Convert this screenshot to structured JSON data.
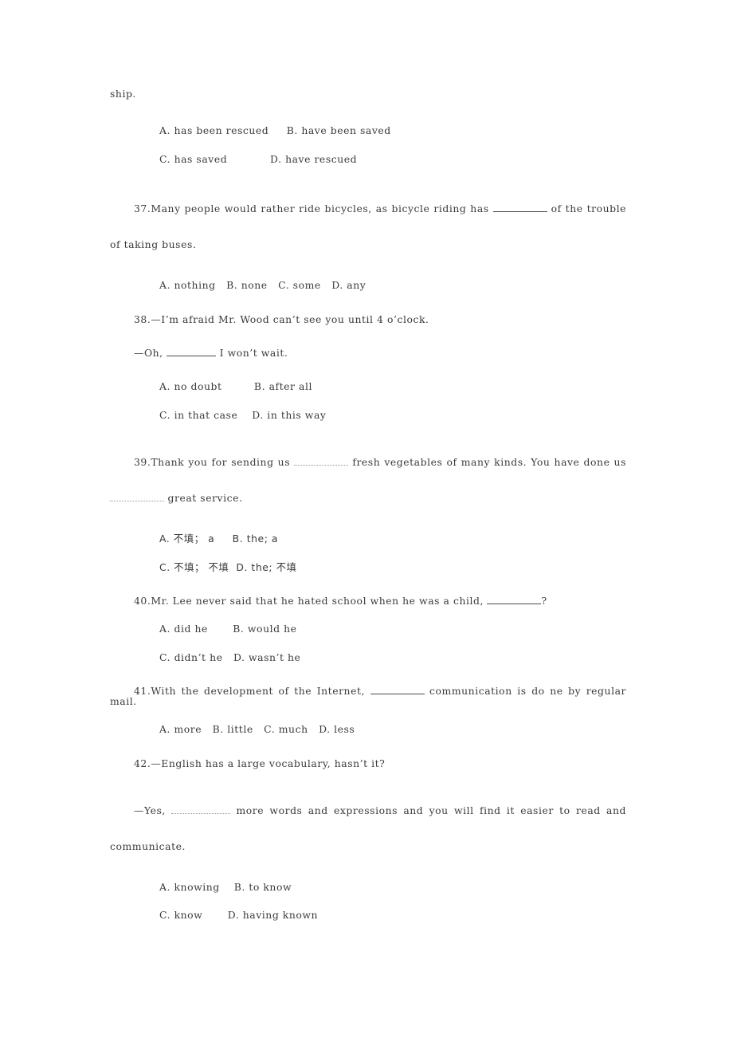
{
  "page": {
    "carryover_text": "ship.",
    "questions": [
      {
        "id": "q36",
        "number": "",
        "stem": "",
        "options_rows": [
          "A. has been rescued     B. have been saved",
          "C. has saved            D. have rescued"
        ]
      },
      {
        "id": "q37",
        "number": "37.",
        "stem_before_blank": "Many people would rather ride bicycles, as bicycle riding has ",
        "stem_after_blank": " of the trouble of taking buses.",
        "blank_style": "solid",
        "options_rows": [
          "A. nothing   B. none   C. some   D. any"
        ]
      },
      {
        "id": "q38",
        "number": "38.",
        "stem": "—I’m afraid Mr. Wood can’t see you until 4 o’clock.",
        "reply_before_blank": "—Oh, ",
        "reply_after_blank": " I won’t wait.",
        "blank_style": "solid",
        "options_rows": [
          "A. no doubt         B. after all",
          "C. in that case    D. in this way"
        ]
      },
      {
        "id": "q39",
        "number": "39.",
        "stem_before_blank": "Thank you for sending us ",
        "stem_mid": " fresh vegetables of many kinds. You have done us ",
        "stem_after_blank": " great service.",
        "blank_style": "faint",
        "options_rows": [
          "A. 不填； a     B. the; a",
          "C. 不填； 不填  D. the; 不填"
        ]
      },
      {
        "id": "q40",
        "number": "40.",
        "stem_before_blank": "Mr. Lee never said that he hated school when he was a child, ",
        "stem_after_blank": "?",
        "blank_style": "solid",
        "options_rows": [
          "A. did he       B. would he",
          "C. didn’t he   D. wasn’t he"
        ]
      },
      {
        "id": "q41",
        "number": "41.",
        "stem_before_blank": "With the development of the Internet, ",
        "stem_after_blank": " communication is do ne by regular mail.",
        "blank_style": "solid",
        "options_rows": [
          "A. more   B. little   C. much   D. less"
        ]
      },
      {
        "id": "q42",
        "number": "42.",
        "stem": "—English has a large vocabulary, hasn’t it?",
        "reply_before_blank": "—Yes, ",
        "reply_after_blank": " more words and expressions and you will find it easier to read and communicate.",
        "blank_style": "faint",
        "options_rows": [
          "A. knowing    B. to know",
          "C. know       D. having known"
        ]
      }
    ]
  }
}
